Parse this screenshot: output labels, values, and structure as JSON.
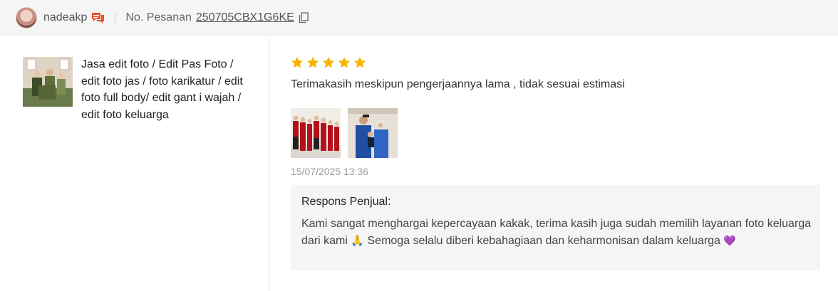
{
  "header": {
    "username": "nadeakp",
    "order_label": "No. Pesanan",
    "order_number": "250705CBX1G6KE",
    "icons": [
      "avatar",
      "chat-icon",
      "copy-icon"
    ]
  },
  "product": {
    "name": "Jasa edit foto / Edit Pas Foto / edit foto jas / foto karikatur / edit foto full body/ edit gant i wajah / edit foto keluarga"
  },
  "review": {
    "rating": 5,
    "rating_max": 5,
    "text": "Terimakasih meskipun pengerjaannya lama , tidak sesuai estimasi",
    "timestamp": "15/07/2025 13:36",
    "photo_count": 2
  },
  "seller_response": {
    "title": "Respons Penjual:",
    "text_part1": "Kami sangat menghargai kepercayaan kakak, terima kasih juga sudah memilih layanan foto keluarga dari kami",
    "emoji1": "🙏",
    "text_part2": "Semoga selalu diberi kebahagiaan dan keharmonisan dalam keluarga",
    "emoji2": "💜"
  },
  "colors": {
    "star": "#f8b400",
    "chat_icon": "#ee4d2d",
    "header_bg": "#f5f5f5",
    "response_bg": "#f5f5f5"
  }
}
